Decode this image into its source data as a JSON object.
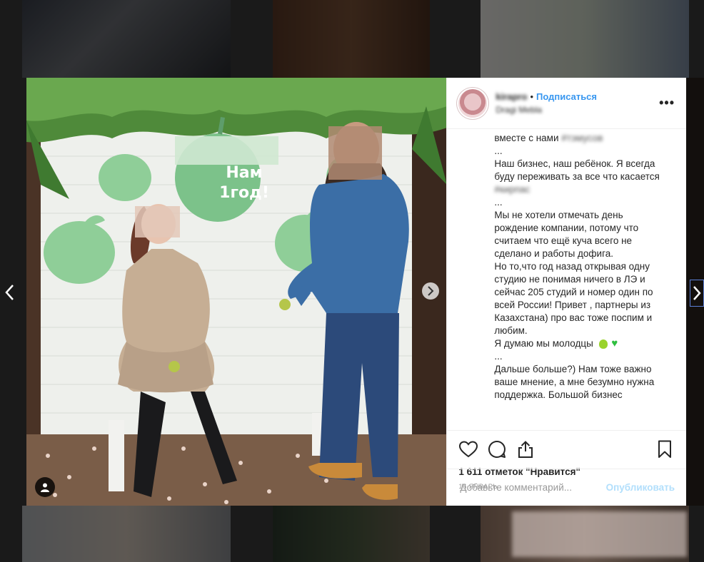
{
  "post": {
    "username": "kirapro",
    "separator": "•",
    "follow_label": "Подписаться",
    "location": "Dragi Mebla",
    "more_label": "•••",
    "sign_text": "Нам 1год!",
    "caption": {
      "line_top": "вместе с нами",
      "line_top_blurred": "#тэмусов",
      "p1": "...",
      "p2": "Наш бизнес, наш ребёнок. Я всегда буду переживать за все что касается",
      "p2_blurred": "#кирпас",
      "p3": "...",
      "p4": "Мы не хотели отмечать день рождение компании, потому что считаем что ещё куча всего не сделано и работы дофига.",
      "p5": "Но то,что год назад открывая одну студию не понимая ничего в ЛЭ и сейчас 205 студий и номер один по всей России! Привет , партнеры из Казахстана) про вас тоже поспим и любим.",
      "p6": "Я думаю мы молодцы",
      "p7": "...",
      "p8": "Дальше больше?) Нам тоже важно ваше мнение, а мне безумно нужна поддержка. Большой бизнес"
    },
    "likes": "1 611 отметок \"Нравится\"",
    "date": "16 ЯНВАРЬ",
    "comment_placeholder": "Добавьте комментарий...",
    "publish_label": "Опубликовать"
  },
  "icons": {
    "like": "heart-icon",
    "comment": "comment-icon",
    "share": "share-icon",
    "save": "bookmark-icon",
    "prev": "chevron-left-icon",
    "next": "chevron-right-icon",
    "photo_next": "chevron-right-icon",
    "user_tag": "user-icon"
  },
  "colors": {
    "accent": "#3897f0",
    "publish_disabled": "#b2dffc"
  }
}
